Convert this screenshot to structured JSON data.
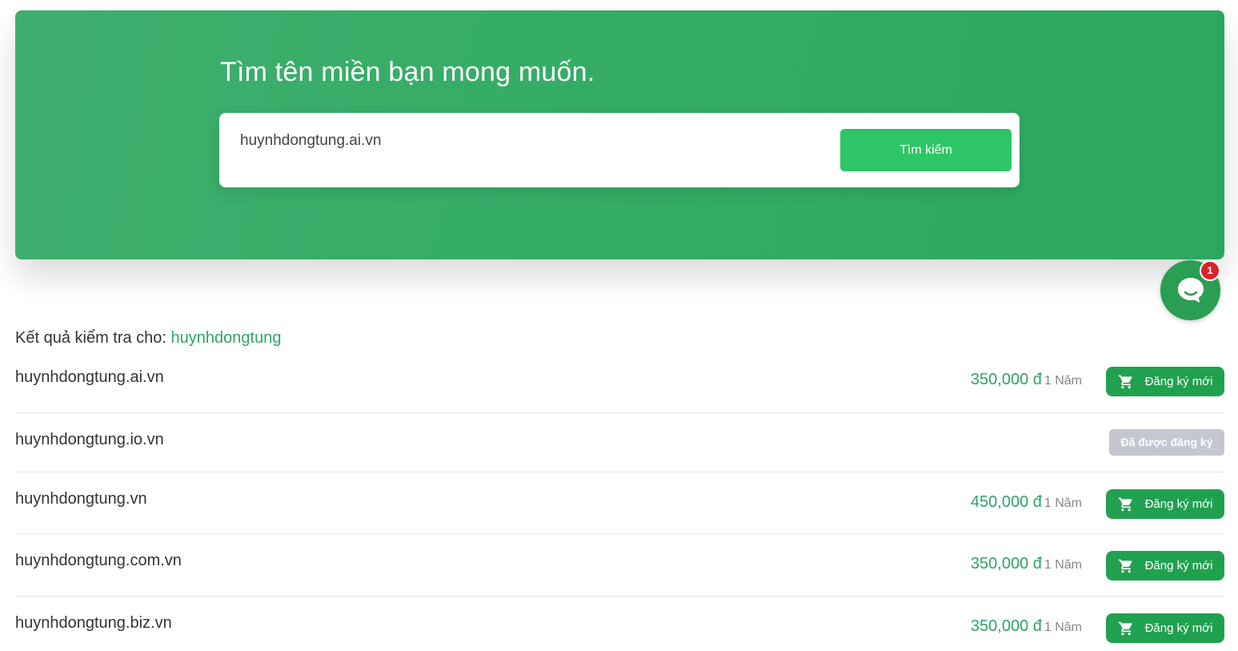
{
  "hero": {
    "title": "Tìm tên miền bạn mong muốn.",
    "search_value": "huynhdongtung.ai.vn",
    "search_button": "Tìm kiếm"
  },
  "chat": {
    "badge_count": "1",
    "icon": "chat-bubble-icon"
  },
  "results": {
    "heading_label": "Kết quả kiểm tra cho:",
    "keyword": "huynhdongtung",
    "register_label": "Đăng ký mới",
    "registered_label": "Đã được đăng ký",
    "items": [
      {
        "domain": "huynhdongtung.ai.vn",
        "price": "350,000 đ",
        "period": "1 Năm",
        "available": true
      },
      {
        "domain": "huynhdongtung.io.vn",
        "price": "",
        "period": "",
        "available": false
      },
      {
        "domain": "huynhdongtung.vn",
        "price": "450,000 đ",
        "period": "1 Năm",
        "available": true
      },
      {
        "domain": "huynhdongtung.com.vn",
        "price": "350,000 đ",
        "period": "1 Năm",
        "available": true
      },
      {
        "domain": "huynhdongtung.biz.vn",
        "price": "350,000 đ",
        "period": "1 Năm",
        "available": true
      }
    ]
  },
  "colors": {
    "accent": "#2ea466",
    "button": "#21a150",
    "hero": "#36ad67",
    "registered": "#c4c7d2"
  }
}
